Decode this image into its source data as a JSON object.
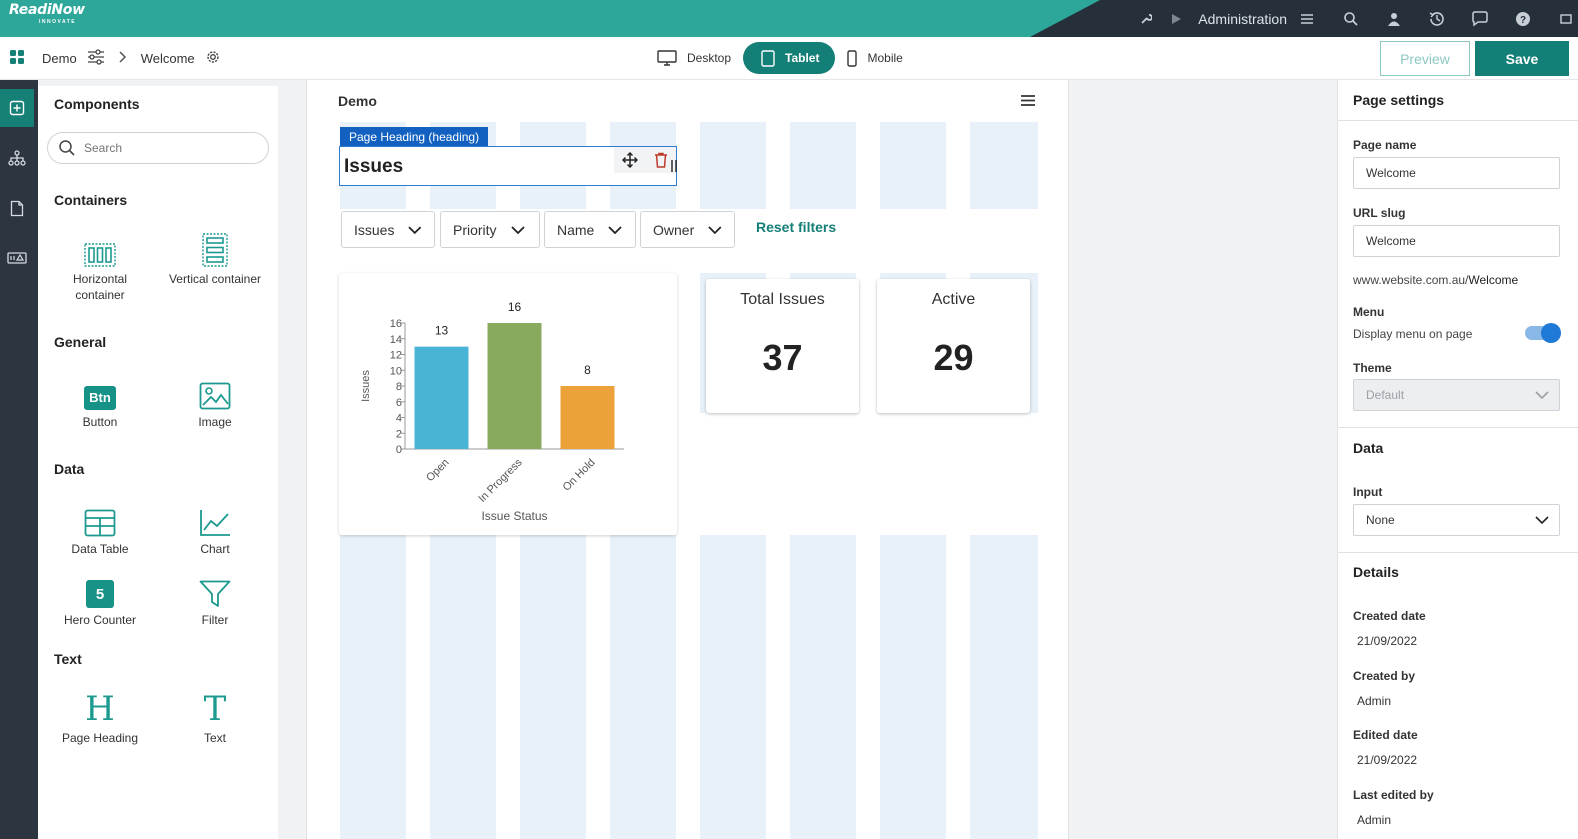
{
  "topbar": {
    "brand": "ReadiNow",
    "brand_sub": "INNOVATE",
    "admin_label": "Administration"
  },
  "subbar": {
    "app_name": "Demo",
    "page_name": "Welcome",
    "devices": [
      "Desktop",
      "Tablet",
      "Mobile"
    ],
    "active_device": "Tablet",
    "preview_label": "Preview",
    "save_label": "Save"
  },
  "components": {
    "title": "Components",
    "search_placeholder": "Search",
    "sections": {
      "containers": "Containers",
      "general": "General",
      "data": "Data",
      "text": "Text"
    },
    "items": {
      "horizontal": "Horizontal container",
      "vertical": "Vertical container",
      "button": "Button",
      "button_glyph": "Btn",
      "image": "Image",
      "data_table": "Data Table",
      "chart": "Chart",
      "hero_counter": "Hero Counter",
      "hero_glyph": "5",
      "filter": "Filter",
      "page_heading": "Page Heading",
      "text": "Text"
    }
  },
  "canvas": {
    "title": "Demo",
    "selected_tag": "Page Heading (heading)",
    "heading_text": "Issues",
    "filters": [
      "Issues",
      "Priority",
      "Name",
      "Owner"
    ],
    "reset_filters": "Reset filters",
    "counters": [
      {
        "label": "Total Issues",
        "value": "37"
      },
      {
        "label": "Active",
        "value": "29"
      }
    ]
  },
  "chart_data": {
    "type": "bar",
    "categories": [
      "Open",
      "In Progress",
      "On Hold"
    ],
    "values": [
      13,
      16,
      8
    ],
    "colors": [
      "#4ab4d6",
      "#88aa5e",
      "#eba23a"
    ],
    "xlabel": "Issue Status",
    "ylabel": "Issues",
    "ylim": [
      0,
      16
    ],
    "yticks": [
      "0",
      "2",
      "4",
      "6",
      "8",
      "10",
      "12",
      "14",
      "16"
    ],
    "show_data_labels": true,
    "grid": false
  },
  "settings": {
    "title": "Page settings",
    "page_name_label": "Page name",
    "page_name_value": "Welcome",
    "url_slug_label": "URL slug",
    "url_slug_value": "Welcome",
    "url_prefix": "www.website.com.au/",
    "url_suffix": "Welcome",
    "menu_label": "Menu",
    "display_menu_label": "Display menu on page",
    "theme_label": "Theme",
    "theme_value": "Default",
    "data_title": "Data",
    "input_label": "Input",
    "input_value": "None",
    "details_title": "Details",
    "created_date_label": "Created date",
    "created_date": "21/09/2022",
    "created_by_label": "Created by",
    "created_by": "Admin",
    "edited_date_label": "Edited date",
    "edited_date": "21/09/2022",
    "last_edited_by_label": "Last edited by",
    "last_edited_by": "Admin"
  }
}
